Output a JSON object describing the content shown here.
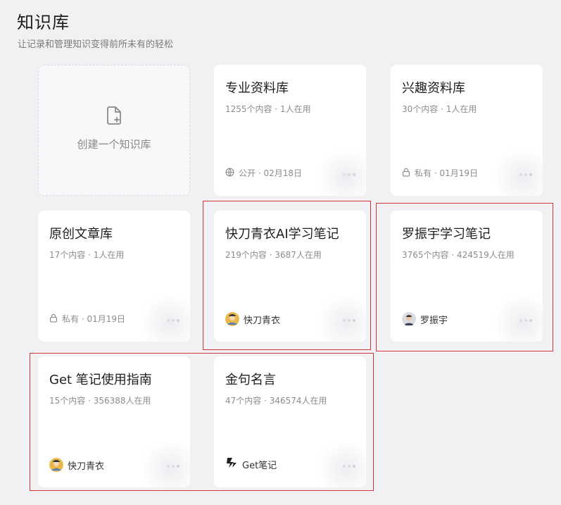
{
  "header": {
    "title": "知识库",
    "subtitle": "让记录和管理知识变得前所未有的轻松"
  },
  "create_card": {
    "label": "创建一个知识库",
    "icon": "file-plus-icon"
  },
  "cards": [
    {
      "title": "专业资料库",
      "meta": "1255个内容 · 1人在用",
      "footer": "公开 · 02月18日",
      "footer_icon": "globe-icon"
    },
    {
      "title": "兴趣资料库",
      "meta": "30个内容 · 1人在用",
      "footer": "私有 · 01月19日",
      "footer_icon": "lock-icon"
    },
    {
      "title": "原创文章库",
      "meta": "17个内容 · 1人在用",
      "footer": "私有 · 01月19日",
      "footer_icon": "lock-icon"
    },
    {
      "title": "快刀青衣AI学习笔记",
      "meta": "219个内容 · 3687人在用",
      "footer": "快刀青衣",
      "footer_icon": "avatar"
    },
    {
      "title": "罗振宇学习笔记",
      "meta": "3765个内容 · 424519人在用",
      "footer": "罗振宇",
      "footer_icon": "avatar"
    },
    {
      "title": "Get 笔记使用指南",
      "meta": "15个内容 · 356388人在用",
      "footer": "快刀青衣",
      "footer_icon": "avatar"
    },
    {
      "title": "金句名言",
      "meta": "47个内容 · 346574人在用",
      "footer": "Get笔记",
      "footer_icon": "get-logo-icon"
    }
  ],
  "colors": {
    "background": "#f1f1f3",
    "card": "#ffffff",
    "highlight_border": "#d2323a"
  }
}
